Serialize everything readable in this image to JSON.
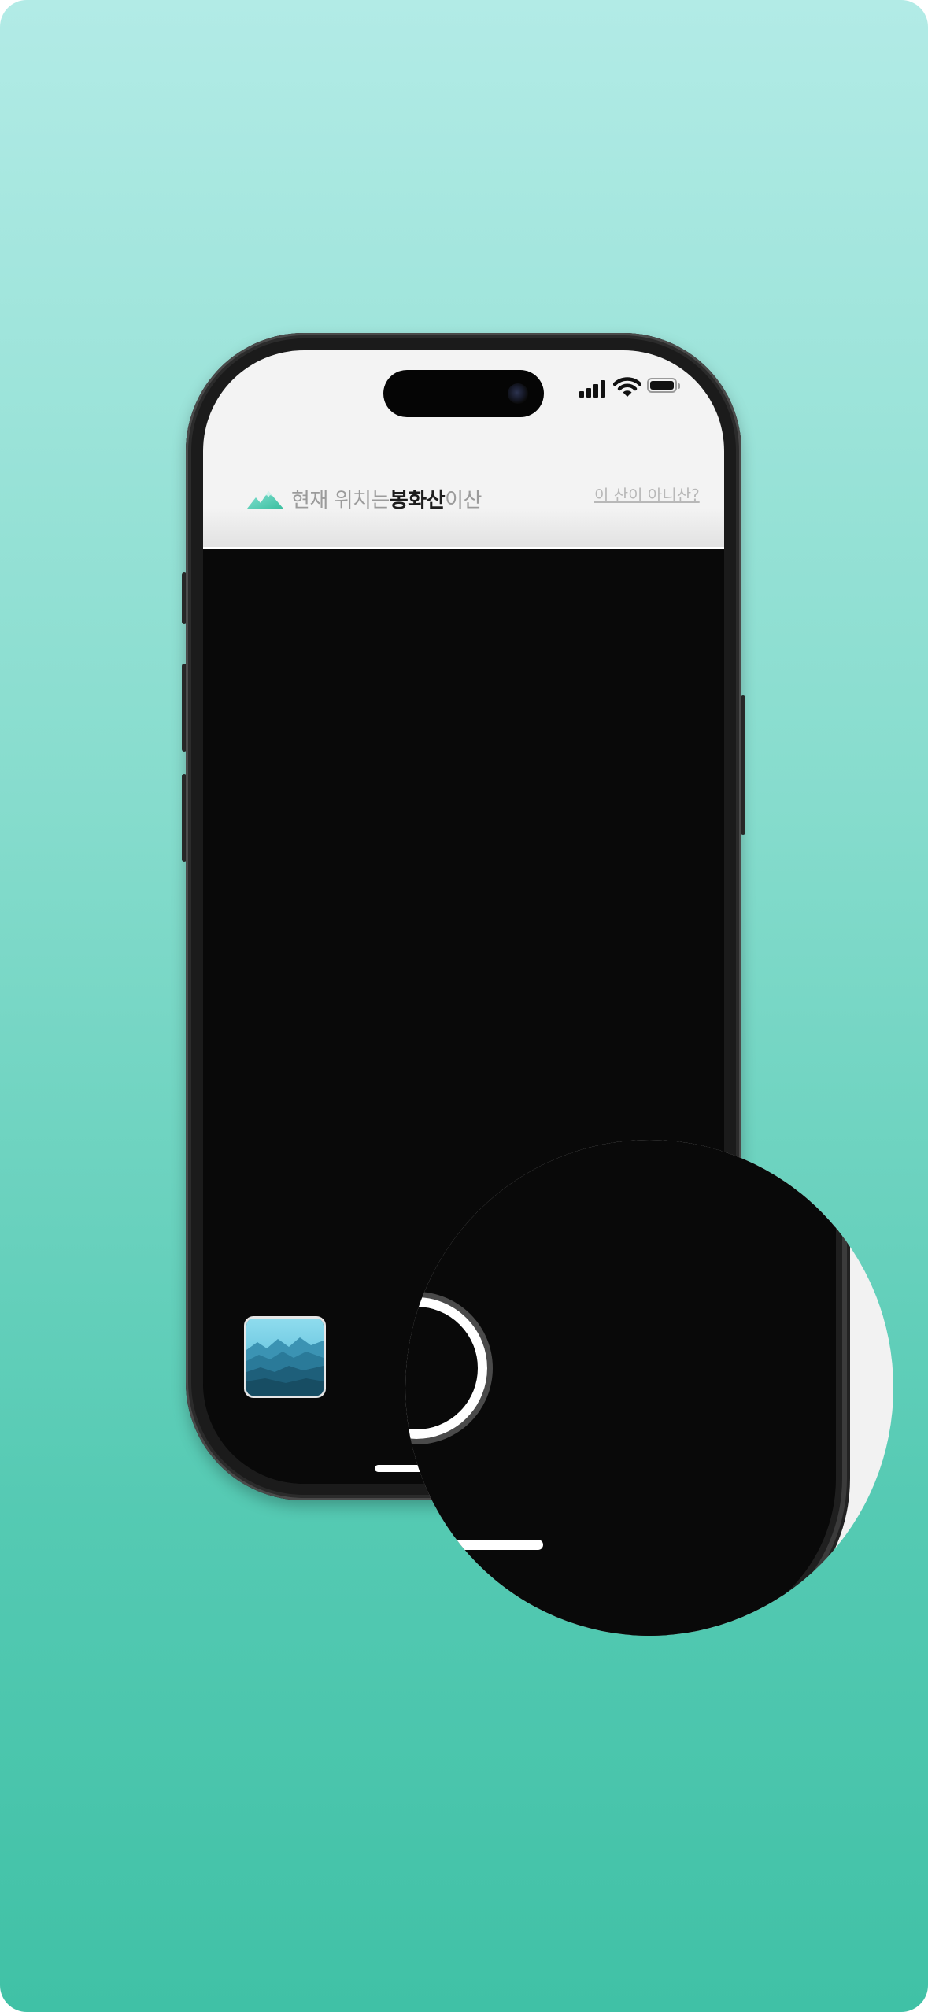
{
  "status_bar": {
    "time": "",
    "signal_icon": "cellular-signal-icon",
    "wifi_icon": "wifi-icon",
    "battery_icon": "battery-icon"
  },
  "header": {
    "logo_icon": "mountain-icon",
    "prefix": "현재 위치는 ",
    "mountain_name": "봉화산",
    "suffix": "이산",
    "not_this_mountain_link": "이 산이 아니산?"
  },
  "camera_controls": {
    "gallery_icon": "gallery-thumbnail-icon",
    "shutter_icon": "shutter-button-icon",
    "recent_photo_icon": "summit-stone-thumbnail-icon"
  },
  "colors": {
    "background_top": "#b2ebe6",
    "background_bottom": "#40c1a6",
    "header_bg": "#f3f3f3",
    "camera_bg": "#090909",
    "accent": "#4fc9b0"
  }
}
